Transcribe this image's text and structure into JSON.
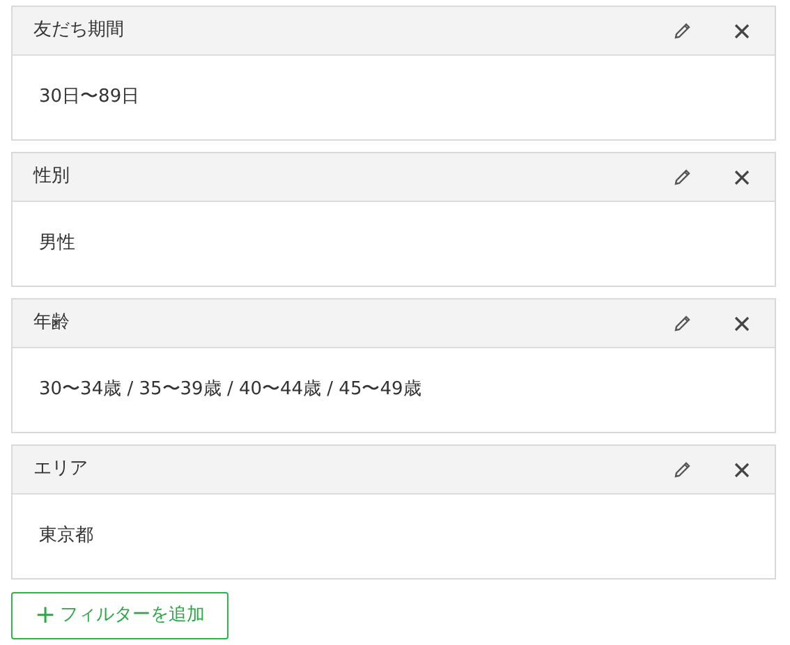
{
  "filters": [
    {
      "title": "友だち期間",
      "value": "30日〜89日"
    },
    {
      "title": "性別",
      "value": "男性"
    },
    {
      "title": "年齢",
      "value": "30〜34歳 / 35〜39歳 / 40〜44歳 / 45〜49歳"
    },
    {
      "title": "エリア",
      "value": "東京都"
    }
  ],
  "add_button": {
    "icon": "+",
    "label": "フィルターを追加"
  }
}
